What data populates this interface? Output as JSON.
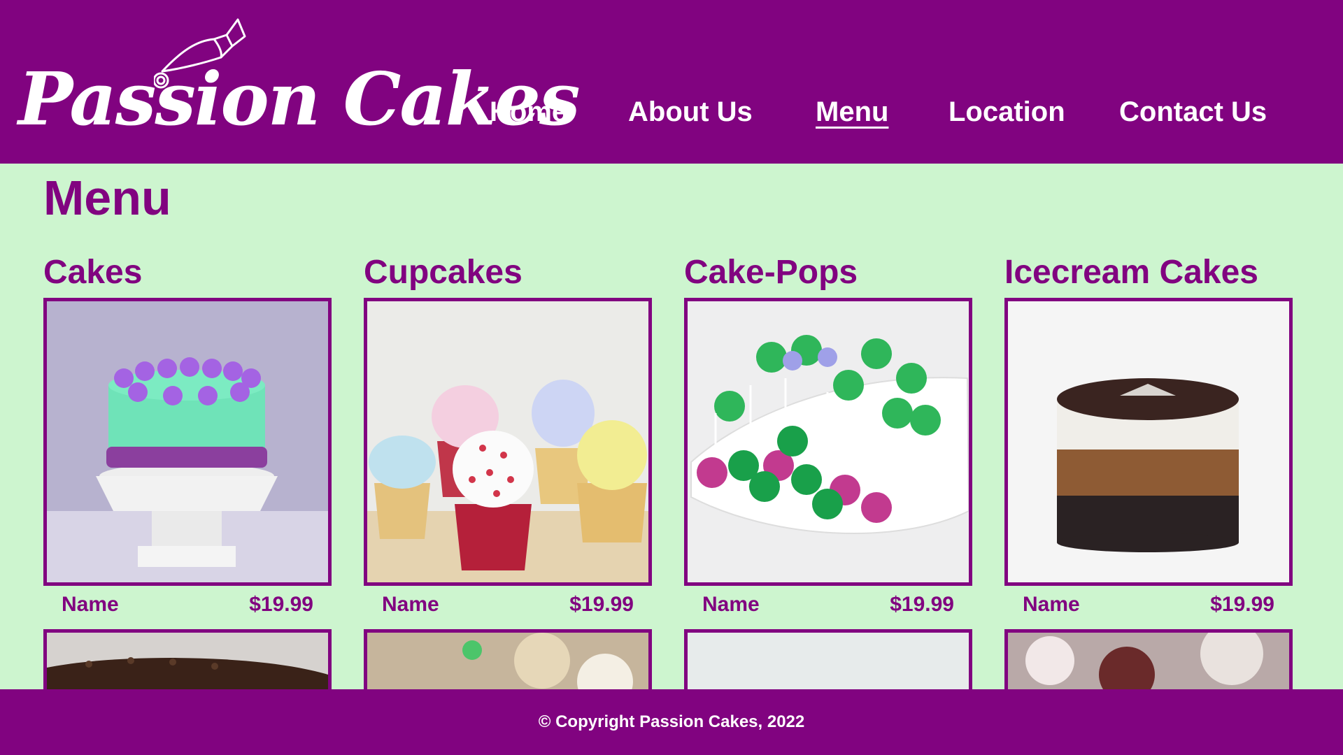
{
  "brand": {
    "name": "Passion Cakes"
  },
  "nav": {
    "items": [
      {
        "label": "Home"
      },
      {
        "label": "About Us"
      },
      {
        "label": "Menu",
        "active": true
      },
      {
        "label": "Location"
      },
      {
        "label": "Contact Us"
      }
    ]
  },
  "page": {
    "title": "Menu"
  },
  "categories": [
    {
      "title": "Cakes",
      "item_name": "Name",
      "price": "$19.99"
    },
    {
      "title": "Cupcakes",
      "item_name": "Name",
      "price": "$19.99"
    },
    {
      "title": "Cake-Pops",
      "item_name": "Name",
      "price": "$19.99"
    },
    {
      "title": "Icecream Cakes",
      "item_name": "Name",
      "price": "$19.99"
    }
  ],
  "footer": {
    "copyright": "© Copyright Passion Cakes, 2022"
  },
  "colors": {
    "brand_purple": "#810380",
    "background_mint": "#cdf5cf"
  }
}
